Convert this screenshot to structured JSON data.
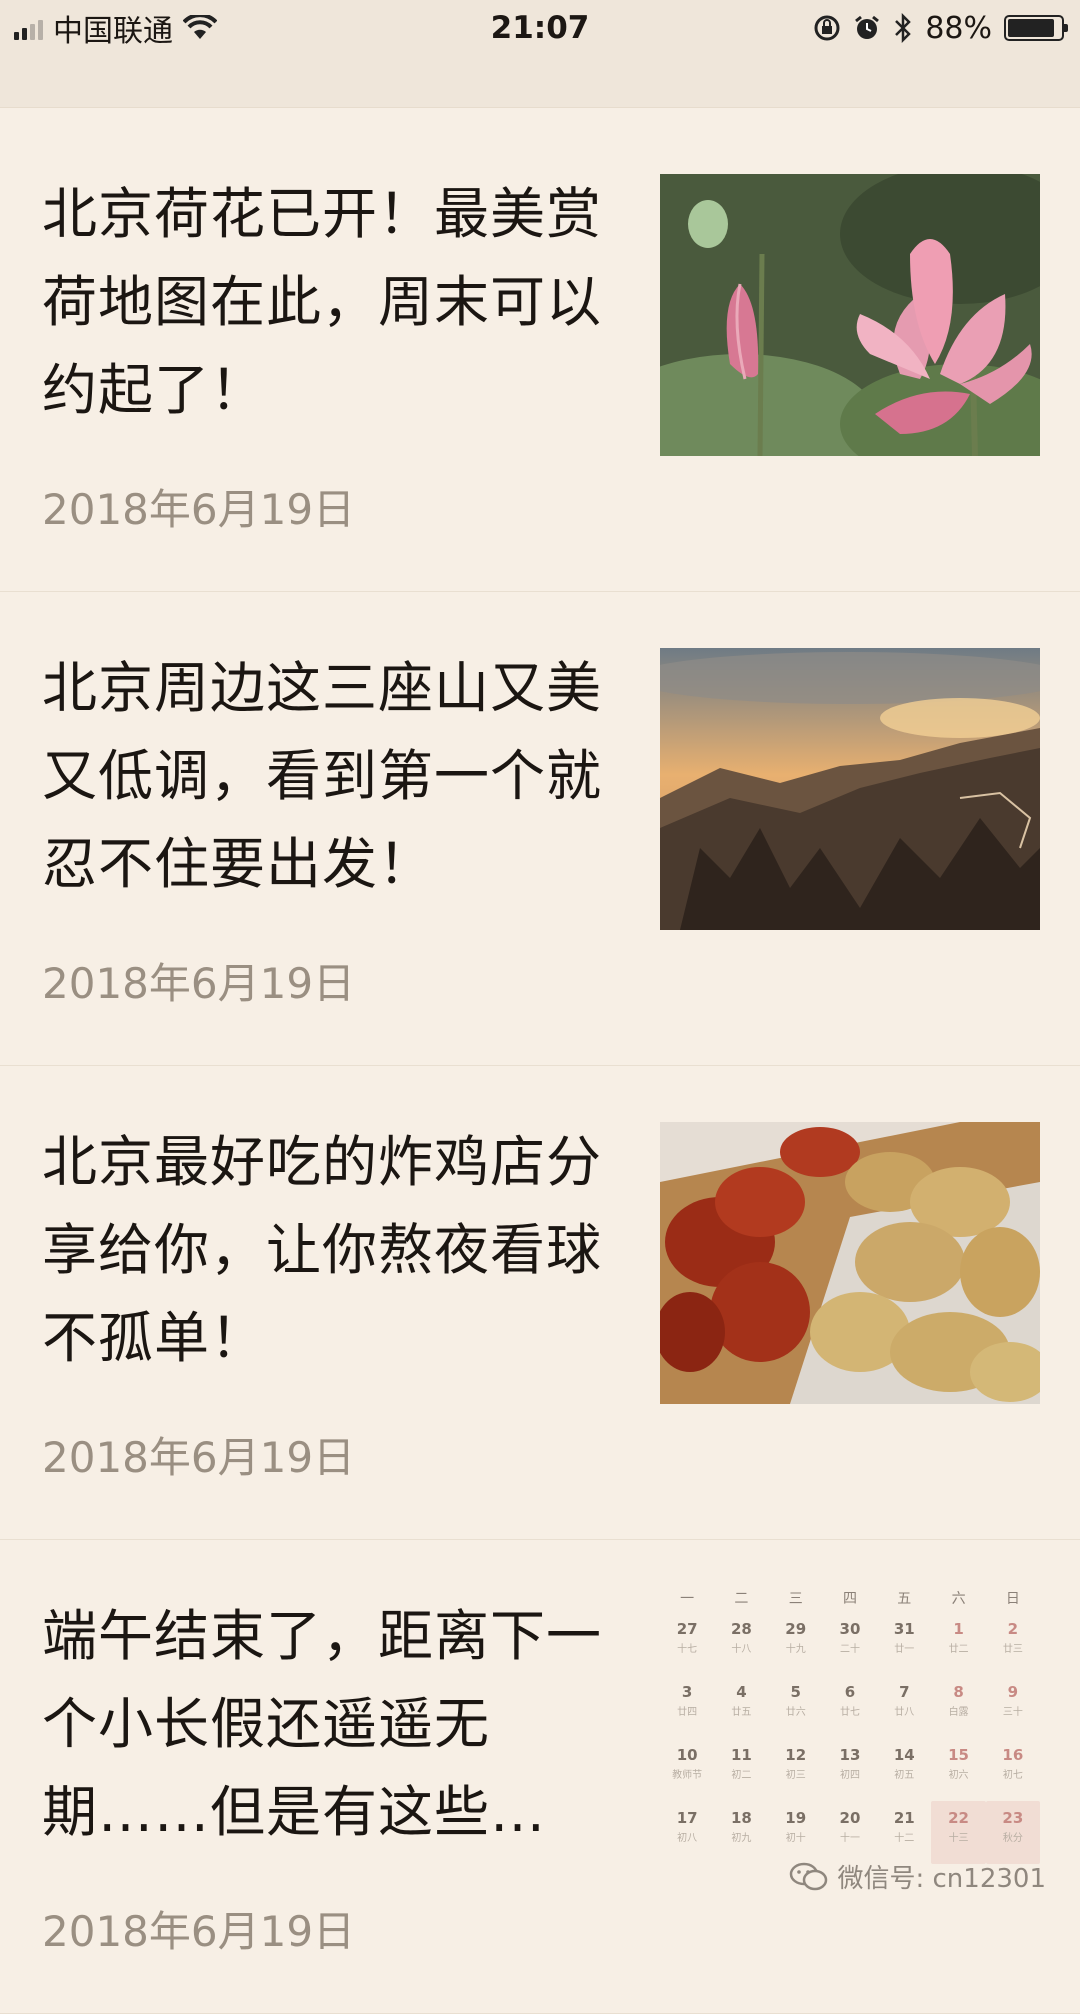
{
  "status_bar": {
    "carrier": "中国联通",
    "time": "21:07",
    "battery_percent": "88%",
    "battery_level": 0.88
  },
  "articles": [
    {
      "title": "北京荷花已开！最美赏荷地图在此，周末可以约起了！",
      "date": "2018年6月19日",
      "thumbnail_icon": "lotus-photo"
    },
    {
      "title": "北京周边这三座山又美又低调，看到第一个就忍不住要出发！",
      "date": "2018年6月19日",
      "thumbnail_icon": "mountain-photo"
    },
    {
      "title": "北京最好吃的炸鸡店分享给你，让你熬夜看球不孤单！",
      "date": "2018年6月19日",
      "thumbnail_icon": "fried-chicken-photo"
    },
    {
      "title": "端午结束了，距离下一个小长假还遥遥无期……但是有这些…",
      "date": "2018年6月19日",
      "thumbnail_icon": "calendar-image"
    }
  ],
  "calendar": {
    "weekdays": [
      "一",
      "二",
      "三",
      "四",
      "五",
      "六",
      "日"
    ],
    "days": [
      [
        "27",
        "28",
        "29",
        "30",
        "31",
        "1",
        "2"
      ],
      [
        "3",
        "4",
        "5",
        "6",
        "7",
        "8",
        "9"
      ],
      [
        "10",
        "11",
        "12",
        "13",
        "14",
        "15",
        "16"
      ],
      [
        "17",
        "18",
        "19",
        "20",
        "21",
        "22",
        "23"
      ]
    ],
    "lunar": [
      [
        "十七",
        "十八",
        "十九",
        "二十",
        "廿一",
        "廿二",
        "廿三"
      ],
      [
        "廿四",
        "廿五",
        "廿六",
        "廿七",
        "廿八",
        "白露",
        "三十"
      ],
      [
        "教师节",
        "初二",
        "初三",
        "初四",
        "初五",
        "初六",
        "初七"
      ],
      [
        "初八",
        "初九",
        "初十",
        "十一",
        "十二",
        "十三",
        "秋分"
      ]
    ]
  },
  "watermark": {
    "text": "微信号: cn12301",
    "icon": "wechat-icon"
  }
}
